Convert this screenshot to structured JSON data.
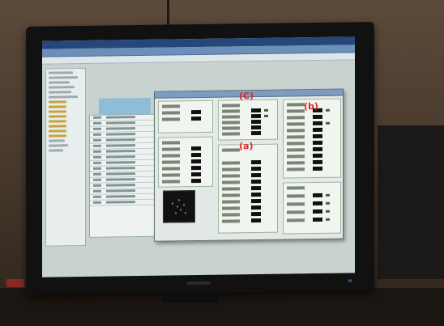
{
  "screen": {
    "tags": [
      "(a)",
      "(b)",
      "(C)"
    ]
  },
  "colors": {
    "tag_red": "#e02828",
    "screen_bg": "#c8d2cf",
    "title_bar": "#26477a",
    "popup_bg": "#e3e9e6",
    "wall": "#4a3b2e"
  }
}
